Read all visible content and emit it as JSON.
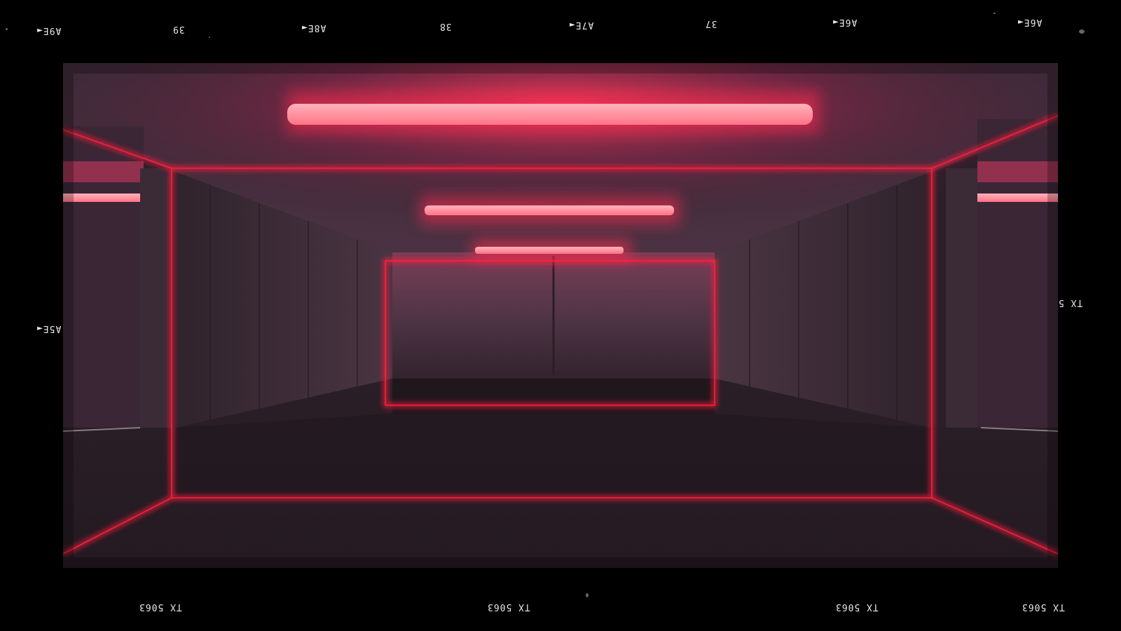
{
  "top_edge": [
    "A6E◄",
    "37",
    "A7E◄",
    "38",
    "A8E◄",
    "39",
    "A9E◄"
  ],
  "top_edge_right": "A9E◄",
  "side_left": "A5E◄",
  "side_right": "TX 5",
  "bottom_edge": [
    "TX 5063",
    "TX 5063",
    "TX 5063",
    "TX 5063"
  ],
  "colors": {
    "neon": "#ff1f3d",
    "tube": "#ff8a98",
    "wall": "#3a2a36",
    "floor": "#2b2128",
    "ceiling": "#4a3644"
  }
}
